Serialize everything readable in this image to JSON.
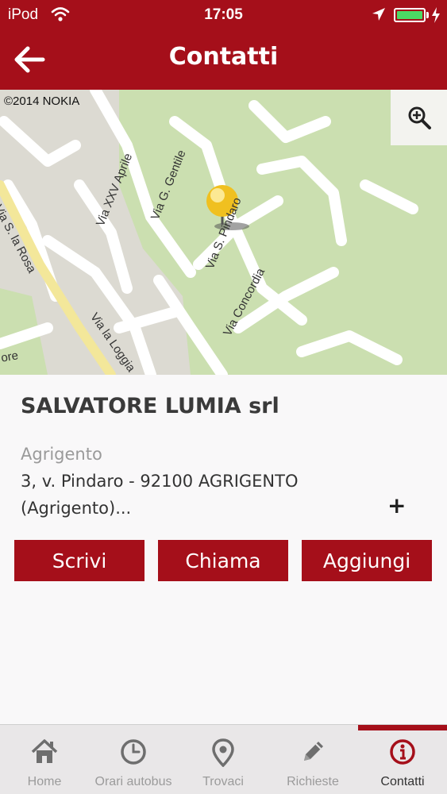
{
  "status_bar": {
    "carrier": "iPod",
    "time": "17:05",
    "icons": [
      "wifi-icon",
      "location-arrow-icon",
      "battery-icon",
      "charging-icon"
    ]
  },
  "nav": {
    "title": "Contatti",
    "back_icon": "arrow-left-icon"
  },
  "map": {
    "copyright": "©2014 NOKIA",
    "zoom_icon": "zoom-in-icon",
    "streets": [
      "Via XXV Aprile",
      "Via G. Gentile",
      "Via S. Pindaro",
      "Via Concordia",
      "Via la Loggia",
      "Via S. la Rosa",
      "ore"
    ],
    "marker_icon": "map-pin-icon"
  },
  "contact": {
    "company": "SALVATORE LUMIA srl",
    "city": "Agrigento",
    "address_line1": "3, v. Pindaro - 92100 AGRIGENTO",
    "address_line2": "(Agrigento)...",
    "expand_symbol": "+"
  },
  "actions": {
    "write": "Scrivi",
    "call": "Chiama",
    "add": "Aggiungi"
  },
  "tabs": [
    {
      "label": "Home",
      "icon": "home-icon",
      "active": false
    },
    {
      "label": "Orari autobus",
      "icon": "clock-icon",
      "active": false
    },
    {
      "label": "Trovaci",
      "icon": "location-pin-icon",
      "active": false
    },
    {
      "label": "Richieste",
      "icon": "pencil-icon",
      "active": false
    },
    {
      "label": "Contatti",
      "icon": "info-icon",
      "active": true
    }
  ],
  "colors": {
    "brand": "#a50f1a",
    "map_green": "#cbdfb0",
    "map_road": "#ffffff",
    "main_road": "#f3e79a"
  }
}
